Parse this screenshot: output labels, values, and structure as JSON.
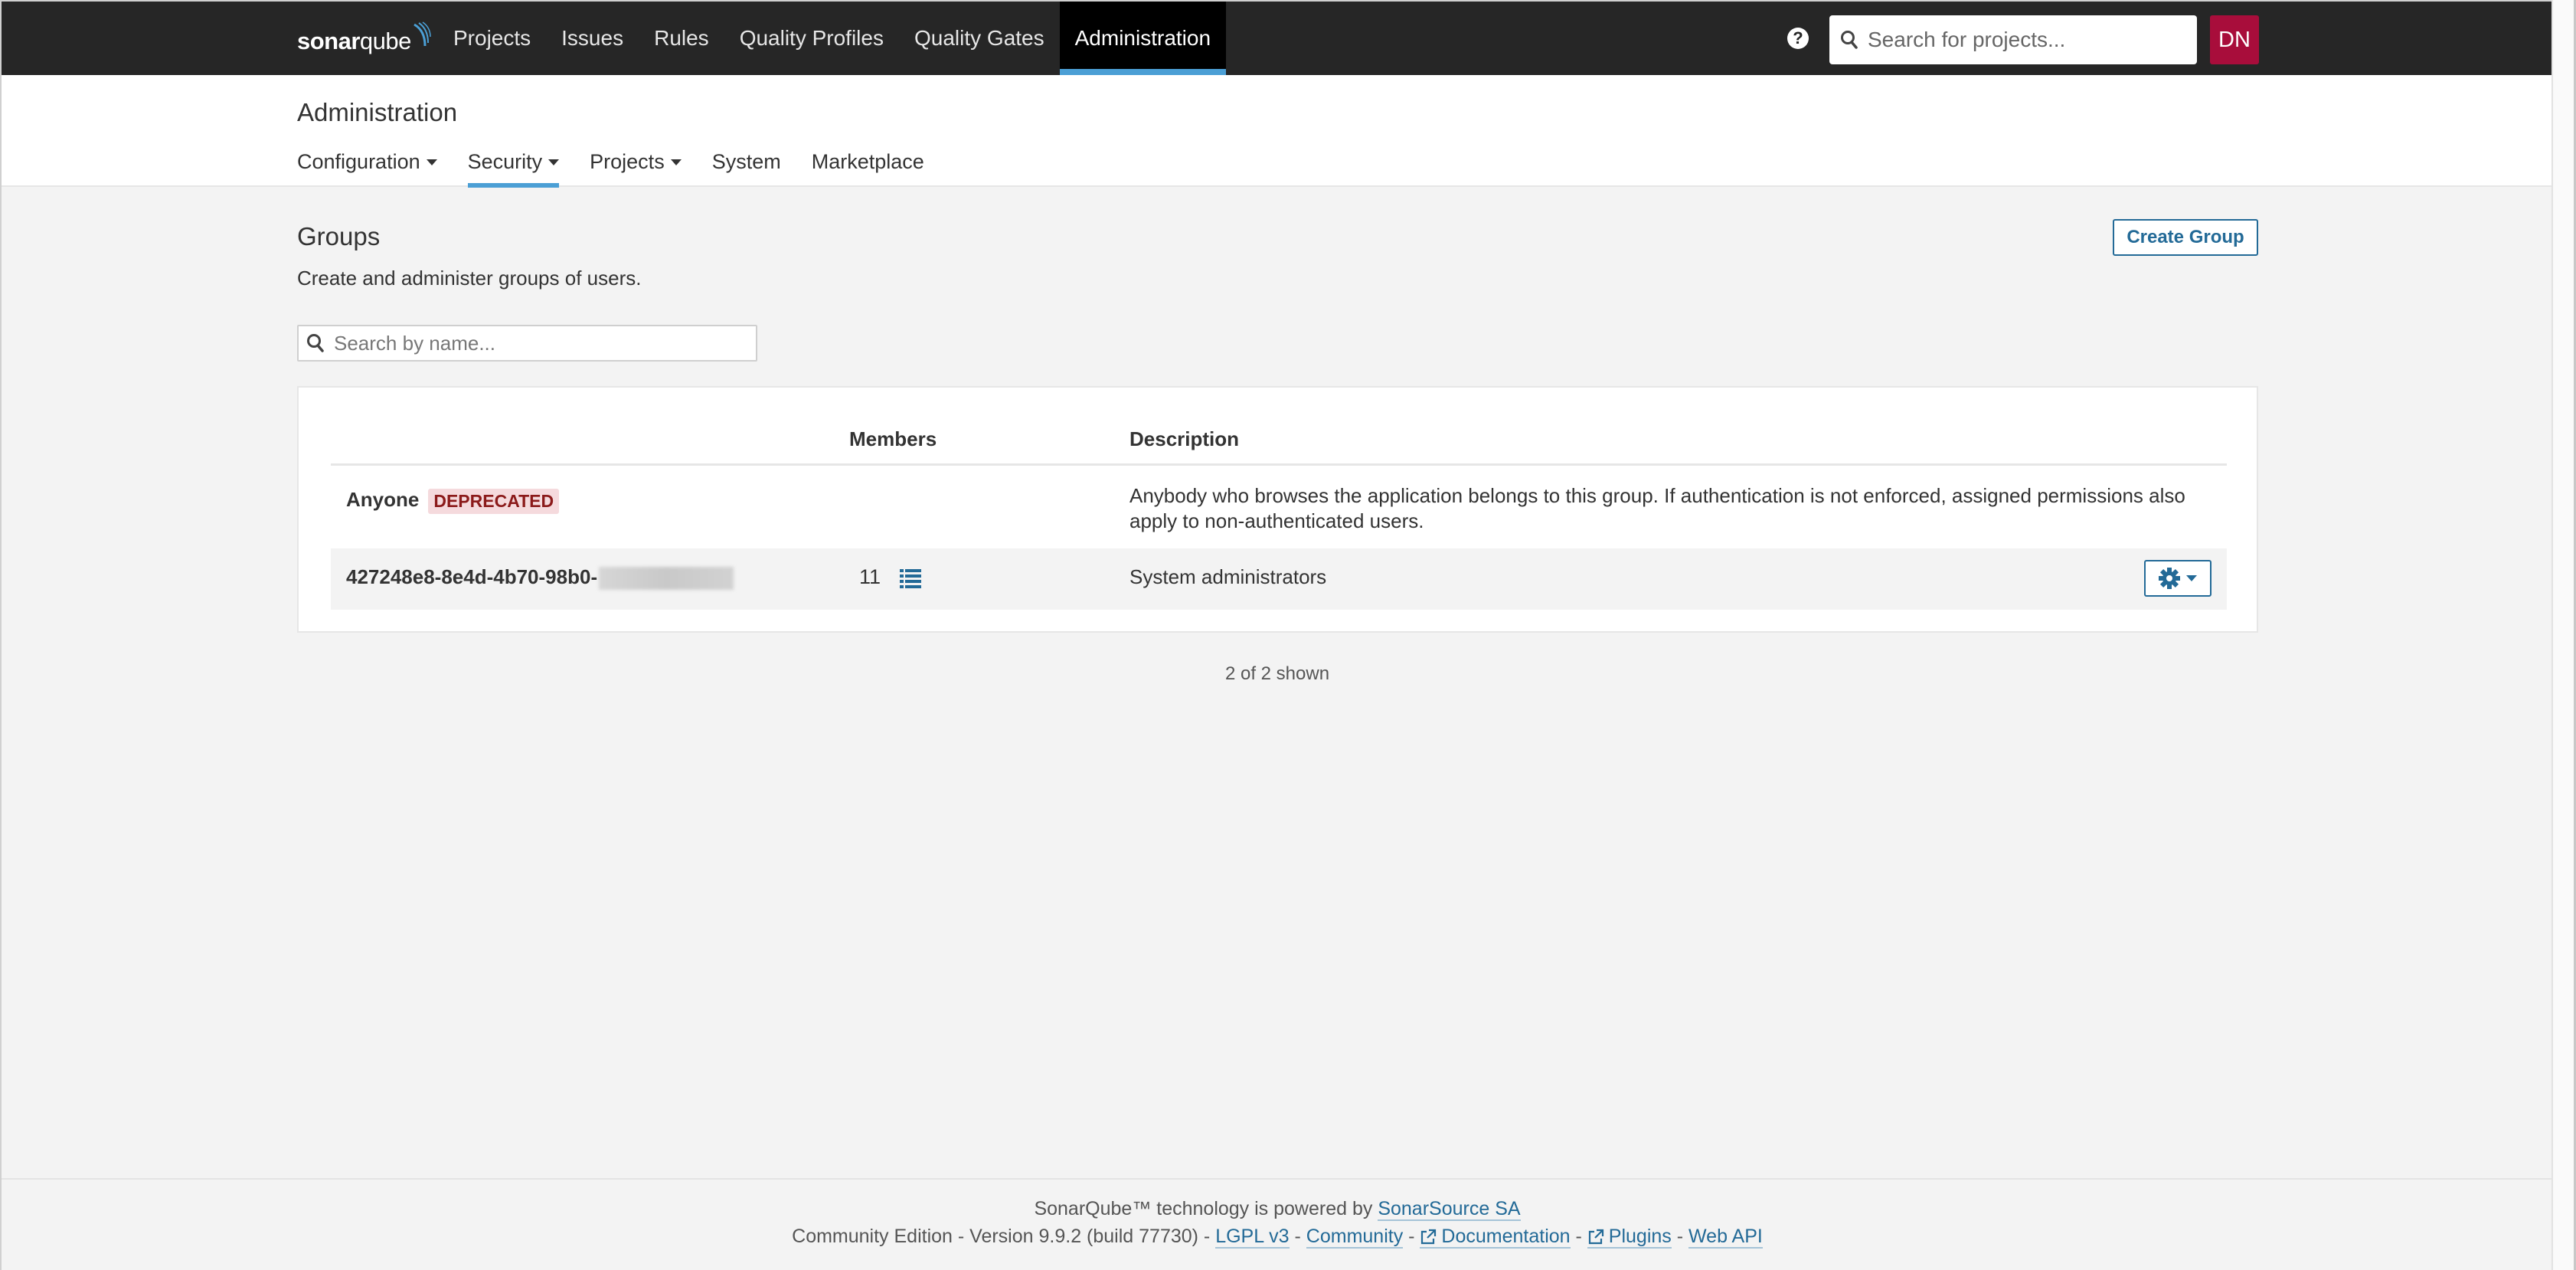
{
  "topnav": {
    "logo": {
      "bold": "sonar",
      "light": "qube"
    },
    "items": [
      {
        "label": "Projects"
      },
      {
        "label": "Issues"
      },
      {
        "label": "Rules"
      },
      {
        "label": "Quality Profiles"
      },
      {
        "label": "Quality Gates"
      },
      {
        "label": "Administration",
        "active": true
      }
    ],
    "help_icon": "?",
    "search_placeholder": "Search for projects...",
    "avatar_initials": "DN",
    "avatar_color": "#a80d3b"
  },
  "page_header": {
    "title": "Administration",
    "subnav": [
      {
        "label": "Configuration",
        "dropdown": true
      },
      {
        "label": "Security",
        "dropdown": true,
        "active": true
      },
      {
        "label": "Projects",
        "dropdown": true
      },
      {
        "label": "System",
        "dropdown": false
      },
      {
        "label": "Marketplace",
        "dropdown": false
      }
    ]
  },
  "groups": {
    "title": "Groups",
    "description": "Create and administer groups of users.",
    "create_button": "Create Group",
    "search_placeholder": "Search by name...",
    "table": {
      "columns": [
        "",
        "Members",
        "Description"
      ],
      "rows": [
        {
          "name": "Anyone",
          "badge": "DEPRECATED",
          "members": "",
          "description": "Anybody who browses the application belongs to this group. If authentication is not enforced, assigned permissions also apply to non-authenticated users."
        },
        {
          "name": "427248e8-8e4d-4b70-98b0-",
          "name_redacted": true,
          "members": "11",
          "description": "System administrators"
        }
      ]
    },
    "shown_count": "2 of 2 shown"
  },
  "footer": {
    "line1_text": "SonarQube™ technology is powered by",
    "line1_link": "SonarSource SA",
    "edition": "Community Edition - Version 9.9.2 (build 77730)",
    "separator": " - ",
    "links": [
      "LGPL v3",
      "Community",
      "Documentation",
      "Plugins",
      "Web API"
    ]
  },
  "colors": {
    "accent": "#236a97",
    "active_underline": "#4b9fd5",
    "topnav_bg": "#262626",
    "badge_bg": "#f5dadd",
    "badge_text": "#8b1a1a"
  }
}
